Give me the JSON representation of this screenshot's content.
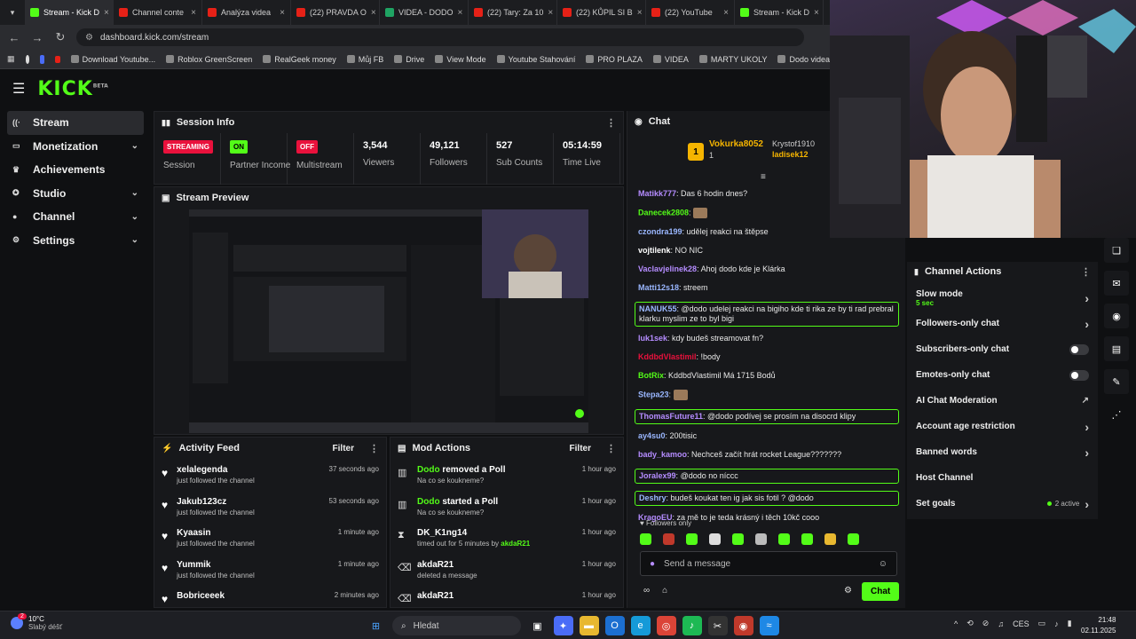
{
  "browser": {
    "tabs": [
      {
        "label": "Stream - Kick D",
        "icon": "kick",
        "active": true
      },
      {
        "label": "Channel conte",
        "icon": "yt"
      },
      {
        "label": "Analýza videa",
        "icon": "yt"
      },
      {
        "label": "(22) PRAVDA O",
        "icon": "yt"
      },
      {
        "label": "VIDEA - DODO",
        "icon": "sheet"
      },
      {
        "label": "(22) Tary: Za 10",
        "icon": "yt"
      },
      {
        "label": "(22) KŮPIL SI B",
        "icon": "yt"
      },
      {
        "label": "(22) YouTube",
        "icon": "yt"
      },
      {
        "label": "Stream - Kick D",
        "icon": "kick"
      }
    ],
    "url": "dashboard.kick.com/stream",
    "bookmarks": [
      "Download Youtube...",
      "Roblox GreenScreen",
      "RealGeek money",
      "Můj FB",
      "Drive",
      "View Mode",
      "Youtube Stahování",
      "PRO PLAZA",
      "VIDEA",
      "MARTY UKOLY",
      "Dodo videa"
    ]
  },
  "logo": {
    "text": "KICK",
    "tag": "BETA"
  },
  "sidebar": {
    "items": [
      {
        "label": "Stream",
        "icon": "wifi-icon",
        "chevron": false,
        "active": true
      },
      {
        "label": "Monetization",
        "icon": "money-icon",
        "chevron": true
      },
      {
        "label": "Achievements",
        "icon": "trophy-icon",
        "chevron": false
      },
      {
        "label": "Studio",
        "icon": "studio-icon",
        "chevron": true
      },
      {
        "label": "Channel",
        "icon": "channel-icon",
        "chevron": true
      },
      {
        "label": "Settings",
        "icon": "gear-icon",
        "chevron": true
      }
    ]
  },
  "session": {
    "title": "Session Info",
    "stats": [
      {
        "badge": "STREAMING",
        "label": "Session",
        "kind": "red"
      },
      {
        "badge": "ON",
        "label": "Partner Income",
        "kind": "green"
      },
      {
        "badge": "OFF",
        "label": "Multistream",
        "kind": "red"
      },
      {
        "value": "3,544",
        "label": "Viewers"
      },
      {
        "value": "49,121",
        "label": "Followers"
      },
      {
        "value": "527",
        "label": "Sub Counts"
      },
      {
        "value": "05:14:59",
        "label": "Time Live"
      }
    ]
  },
  "preview": {
    "title": "Stream Preview"
  },
  "activity": {
    "title": "Activity Feed",
    "filter": "Filter",
    "items": [
      {
        "name": "xelalegenda",
        "action": "just followed the channel",
        "time": "37 seconds ago"
      },
      {
        "name": "Jakub123cz",
        "action": "just followed the channel",
        "time": "53 seconds ago"
      },
      {
        "name": "Kyaasin",
        "action": "just followed the channel",
        "time": "1 minute ago"
      },
      {
        "name": "Yummik",
        "action": "just followed the channel",
        "time": "1 minute ago"
      },
      {
        "name": "Bobriceeek",
        "action": "",
        "time": "2 minutes ago"
      }
    ]
  },
  "mod": {
    "title": "Mod Actions",
    "filter": "Filter",
    "items": [
      {
        "who": "Dodo",
        "action": "removed a Poll",
        "detail": "Na co se koukneme?",
        "time": "1 hour ago",
        "icon": "poll-icon"
      },
      {
        "who": "Dodo",
        "action": "started a Poll",
        "detail": "Na co se koukneme?",
        "time": "1 hour ago",
        "icon": "poll-icon"
      },
      {
        "who": "DK_K1ng14",
        "action": "",
        "detail": "timed out for 5 minutes by",
        "by": "akdaR21",
        "time": "1 hour ago",
        "icon": "hourglass-icon"
      },
      {
        "who": "akdaR21",
        "action": "",
        "detail": "deleted a message",
        "time": "1 hour ago",
        "icon": "trash-icon"
      },
      {
        "who": "akdaR21",
        "action": "",
        "detail": "",
        "time": "1 hour ago",
        "icon": "trash-icon"
      }
    ]
  },
  "chat": {
    "title": "Chat",
    "top_gifter": {
      "rank": "1",
      "name": "Vokurka8052",
      "count": "1"
    },
    "others": [
      "Krystof1910",
      "ladisek12"
    ],
    "messages": [
      {
        "user": "Matikk777",
        "color": "#b58cff",
        "text": "Das 6 hodin dnes?"
      },
      {
        "user": "Danecek2808",
        "color": "#53fc18",
        "text": "",
        "emote": true
      },
      {
        "user": "czondra199",
        "color": "#9ab7ff",
        "text": "udělej reakci na štěpse"
      },
      {
        "user": "vojtilenk",
        "color": "#ffffff",
        "text": "NO NIC"
      },
      {
        "user": "Vaclavjelinek28",
        "color": "#b58cff",
        "text": "Ahoj dodo kde je Klárka"
      },
      {
        "user": "Matti12s18",
        "color": "#9ab7ff",
        "text": "streem"
      },
      {
        "user": "NANUK55",
        "color": "#9ab7ff",
        "text": "@dodo udelej reakci na bigiho kde ti rika ze by ti rad prebral klarku myslim ze to byl bigi",
        "hl": true
      },
      {
        "user": "luk1sek",
        "color": "#b58cff",
        "text": "kdy budeš streamovat fn?"
      },
      {
        "user": "KddbdVlastimil",
        "color": "#e9113c",
        "text": "!body"
      },
      {
        "user": "BotRix",
        "color": "#53fc18",
        "text": "KddbdVlastimil Má 1715 Bodů"
      },
      {
        "user": "Stepa23",
        "color": "#9ab7ff",
        "text": "",
        "emote": true
      },
      {
        "user": "ThomasFuture11",
        "color": "#b58cff",
        "text": "@dodo podívej se prosím na disocrd klipy",
        "hl": true
      },
      {
        "user": "ay4su0",
        "color": "#9ab7ff",
        "text": "200tisic"
      },
      {
        "user": "bady_kamoo",
        "color": "#b58cff",
        "text": "Nechceš začít hrát rocket League???????"
      },
      {
        "user": "Joralex99",
        "color": "#b58cff",
        "text": "@dodo no níccc",
        "hl": true
      },
      {
        "user": "Deshry",
        "color": "#9ab7ff",
        "text": "budeš koukat ten ig jak sis fotil ? @dodo",
        "hl": true
      },
      {
        "user": "KragoEU",
        "color": "#b58cff",
        "text": "za mě to je teda krásný i těch 10kč cooo"
      }
    ],
    "followers_only": "Followers only",
    "placeholder": "Send a message",
    "send": "Chat"
  },
  "channel_actions": {
    "title": "Channel Actions",
    "rows": [
      {
        "label": "Slow mode",
        "sub": "5 sec",
        "ctrl": "chevron"
      },
      {
        "label": "Followers-only chat",
        "ctrl": "chevron"
      },
      {
        "label": "Subscribers-only chat",
        "ctrl": "toggle"
      },
      {
        "label": "Emotes-only chat",
        "ctrl": "toggle"
      },
      {
        "label": "AI Chat Moderation",
        "ctrl": "external"
      },
      {
        "label": "Account age restriction",
        "ctrl": "chevron"
      },
      {
        "label": "Banned words",
        "ctrl": "chevron"
      },
      {
        "label": "Host Channel",
        "ctrl": "none"
      },
      {
        "label": "Set goals",
        "ctrl": "chevron",
        "status": "2 active"
      }
    ]
  },
  "taskbar": {
    "weather_temp": "10°C",
    "weather_desc": "Slabý déšť",
    "notif": "2",
    "search": "Hledat",
    "lang": "CES",
    "time": "21:48",
    "date": "02.11.2025"
  },
  "colors": {
    "accent": "#53fc18",
    "live": "#e9113c",
    "bg": "#0f1012",
    "panel": "#17181b"
  }
}
